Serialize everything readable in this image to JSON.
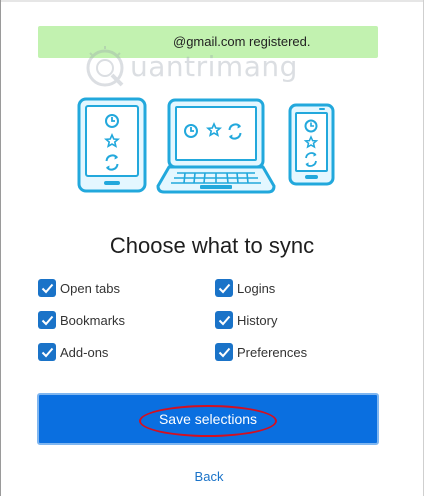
{
  "banner": {
    "text": "@gmail.com registered."
  },
  "watermark": {
    "text": "uantrimang",
    "logo_icon": "lightbulb-q-icon"
  },
  "illustration": {
    "devices": [
      "tablet",
      "laptop",
      "phone"
    ],
    "icons": [
      "clock-icon",
      "star-icon",
      "sync-icon"
    ],
    "stroke_color": "#22a8dc",
    "fill_color": "#e4f7ff"
  },
  "title": "Choose what to sync",
  "options": [
    {
      "label": "Open tabs",
      "checked": true
    },
    {
      "label": "Logins",
      "checked": true
    },
    {
      "label": "Bookmarks",
      "checked": true
    },
    {
      "label": "History",
      "checked": true
    },
    {
      "label": "Add-ons",
      "checked": true
    },
    {
      "label": "Preferences",
      "checked": true
    }
  ],
  "save_button": {
    "label": "Save selections",
    "color": "#0a6fe0",
    "highlight_ring_color": "#d40f20"
  },
  "back_link": {
    "label": "Back",
    "color": "#1a73c8"
  },
  "checkbox_color": "#1a73c8"
}
